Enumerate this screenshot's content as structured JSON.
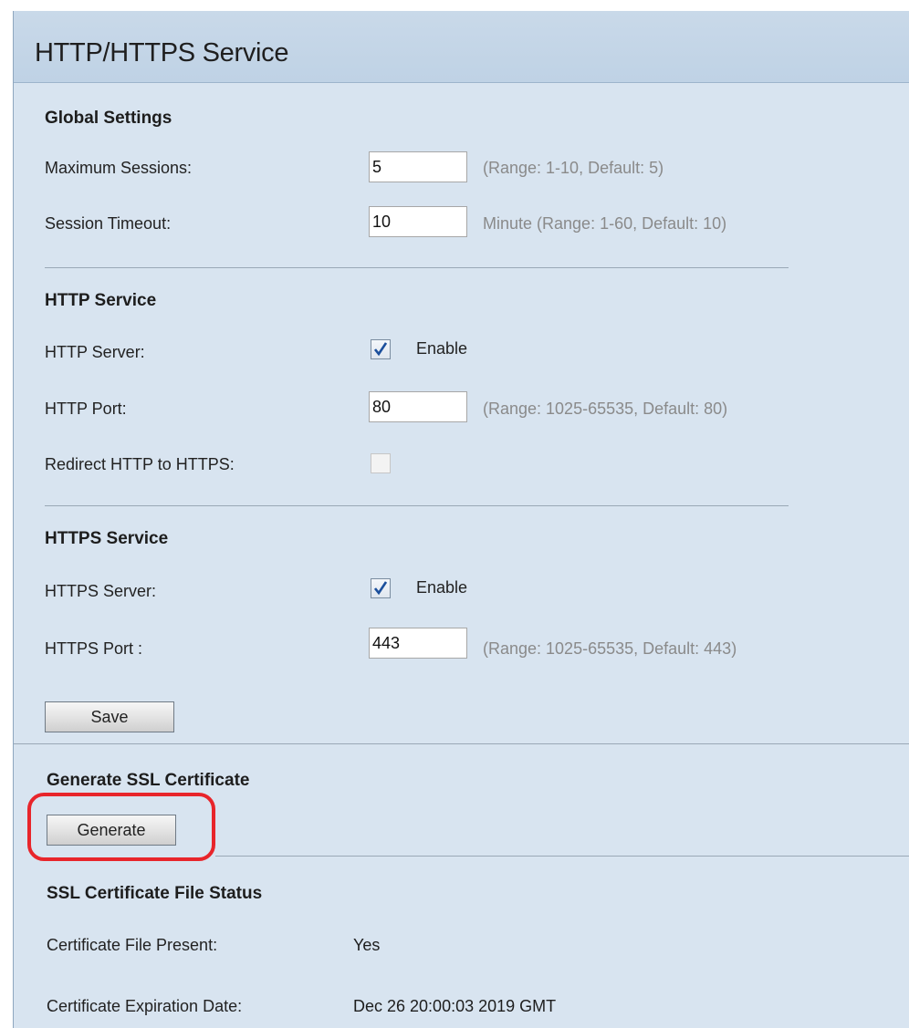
{
  "page": {
    "title": "HTTP/HTTPS Service"
  },
  "global": {
    "heading": "Global Settings",
    "max_sessions": {
      "label": "Maximum Sessions:",
      "value": "5",
      "hint": "(Range: 1-10, Default: 5)"
    },
    "session_timeout": {
      "label": "Session Timeout:",
      "value": "10",
      "hint": "Minute (Range: 1-60, Default: 10)"
    }
  },
  "http": {
    "heading": "HTTP Service",
    "server": {
      "label": "HTTP Server:",
      "checked": true,
      "option": "Enable"
    },
    "port": {
      "label": "HTTP Port:",
      "value": "80",
      "hint": "(Range: 1025-65535, Default: 80)"
    },
    "redirect": {
      "label": "Redirect HTTP to HTTPS:",
      "checked": false,
      "enabled": false
    }
  },
  "https": {
    "heading": "HTTPS Service",
    "server": {
      "label": "HTTPS Server:",
      "checked": true,
      "option": "Enable"
    },
    "port": {
      "label": "HTTPS Port :",
      "value": "443",
      "hint": "(Range: 1025-65535, Default: 443)"
    }
  },
  "actions": {
    "save_label": "Save"
  },
  "ssl": {
    "heading": "Generate SSL Certificate",
    "generate_label": "Generate",
    "highlight_color": "#e8252b"
  },
  "status": {
    "heading": "SSL Certificate File Status",
    "present": {
      "label": "Certificate File Present:",
      "value": "Yes"
    },
    "expiration": {
      "label": "Certificate Expiration Date:",
      "value": "Dec 26 20:00:03 2019 GMT"
    }
  },
  "icons": {
    "checkmark": "checkmark-icon"
  }
}
